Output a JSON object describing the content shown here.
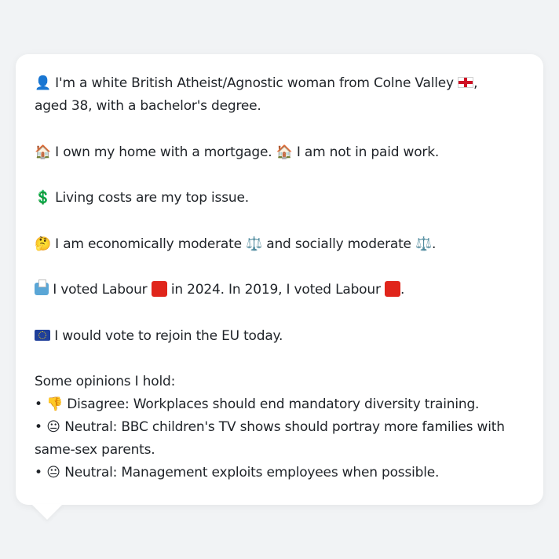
{
  "persona": {
    "line1": {
      "icon": "person-silhouette-icon",
      "icon_glyph": "👤",
      "text_a": " I'm a white British Atheist/Agnostic woman from Colne Valley ",
      "flag": "england-flag-icon",
      "text_b": ", aged 38, with a bachelor's degree."
    },
    "line2": {
      "icon_glyph": "🏠",
      "text_a": " I own my home with a mortgage. ",
      "icon2_glyph": "🏠",
      "text_b": " I am not in paid work."
    },
    "line3": {
      "icon_glyph": "💲",
      "text": " Living costs are my top issue."
    },
    "line4": {
      "icon_glyph": "🤔",
      "text_a": " I am economically moderate ",
      "scale1_glyph": "⚖️",
      "text_b": " and socially moderate ",
      "scale2_glyph": "⚖️",
      "text_c": "."
    },
    "line5": {
      "text_a": " I voted Labour ",
      "text_b": " in 2024. In 2019, I voted Labour ",
      "text_c": ".",
      "party_color": "#e0251b"
    },
    "line6": {
      "text": " I would vote to rejoin the EU today."
    },
    "opinions": {
      "heading": "Some opinions I hold:",
      "items": [
        {
          "bullet": "•",
          "icon_glyph": "👎",
          "text": " Disagree: Workplaces should end mandatory diversity training."
        },
        {
          "bullet": "•",
          "icon_glyph": "😐",
          "text": " Neutral: BBC children's TV shows should portray more families with same-sex parents."
        },
        {
          "bullet": "•",
          "icon_glyph": "😐",
          "text": " Neutral: Management exploits employees when possible."
        }
      ]
    }
  }
}
